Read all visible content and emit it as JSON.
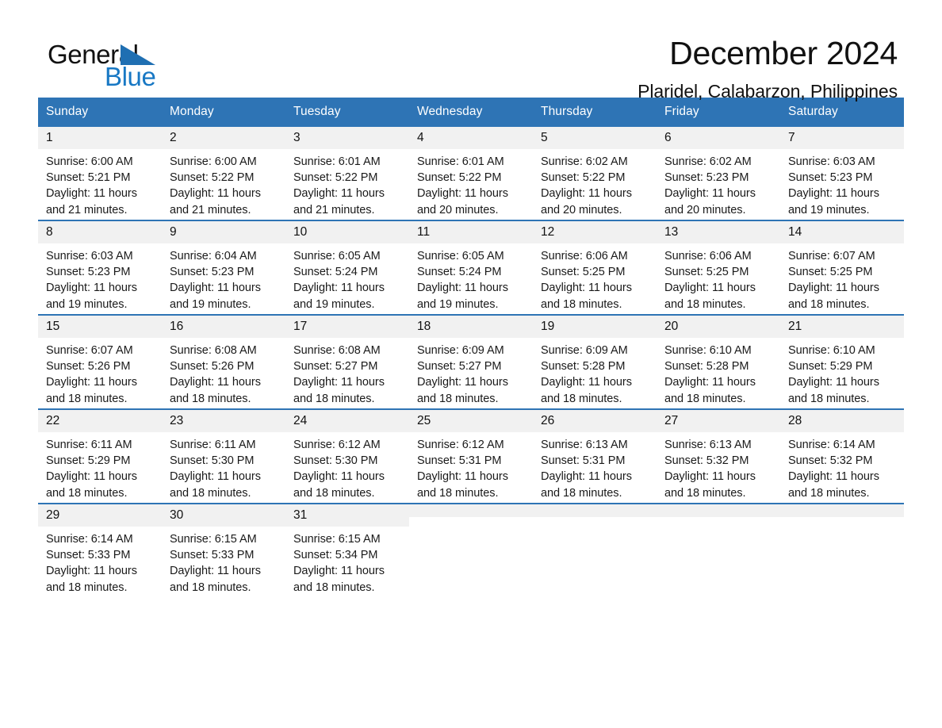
{
  "brand": {
    "name_part1": "General",
    "name_part2": "Blue",
    "triangle_color": "#1F6FB2",
    "blue_color": "#1878C4"
  },
  "header": {
    "title": "December 2024",
    "location": "Plaridel, Calabarzon, Philippines"
  },
  "theme": {
    "header_blue": "#2E74B5",
    "daynum_gray": "#F1F1F1",
    "text_color": "#111111"
  },
  "weekday_headers": [
    "Sunday",
    "Monday",
    "Tuesday",
    "Wednesday",
    "Thursday",
    "Friday",
    "Saturday"
  ],
  "labels": {
    "sunrise_prefix": "Sunrise:",
    "sunset_prefix": "Sunset:",
    "daylight_prefix": "Daylight:"
  },
  "weeks": [
    [
      {
        "day": "1",
        "sunrise": "Sunrise: 6:00 AM",
        "sunset": "Sunset: 5:21 PM",
        "daylight_line1": "Daylight: 11 hours",
        "daylight_line2": "and 21 minutes."
      },
      {
        "day": "2",
        "sunrise": "Sunrise: 6:00 AM",
        "sunset": "Sunset: 5:22 PM",
        "daylight_line1": "Daylight: 11 hours",
        "daylight_line2": "and 21 minutes."
      },
      {
        "day": "3",
        "sunrise": "Sunrise: 6:01 AM",
        "sunset": "Sunset: 5:22 PM",
        "daylight_line1": "Daylight: 11 hours",
        "daylight_line2": "and 21 minutes."
      },
      {
        "day": "4",
        "sunrise": "Sunrise: 6:01 AM",
        "sunset": "Sunset: 5:22 PM",
        "daylight_line1": "Daylight: 11 hours",
        "daylight_line2": "and 20 minutes."
      },
      {
        "day": "5",
        "sunrise": "Sunrise: 6:02 AM",
        "sunset": "Sunset: 5:22 PM",
        "daylight_line1": "Daylight: 11 hours",
        "daylight_line2": "and 20 minutes."
      },
      {
        "day": "6",
        "sunrise": "Sunrise: 6:02 AM",
        "sunset": "Sunset: 5:23 PM",
        "daylight_line1": "Daylight: 11 hours",
        "daylight_line2": "and 20 minutes."
      },
      {
        "day": "7",
        "sunrise": "Sunrise: 6:03 AM",
        "sunset": "Sunset: 5:23 PM",
        "daylight_line1": "Daylight: 11 hours",
        "daylight_line2": "and 19 minutes."
      }
    ],
    [
      {
        "day": "8",
        "sunrise": "Sunrise: 6:03 AM",
        "sunset": "Sunset: 5:23 PM",
        "daylight_line1": "Daylight: 11 hours",
        "daylight_line2": "and 19 minutes."
      },
      {
        "day": "9",
        "sunrise": "Sunrise: 6:04 AM",
        "sunset": "Sunset: 5:23 PM",
        "daylight_line1": "Daylight: 11 hours",
        "daylight_line2": "and 19 minutes."
      },
      {
        "day": "10",
        "sunrise": "Sunrise: 6:05 AM",
        "sunset": "Sunset: 5:24 PM",
        "daylight_line1": "Daylight: 11 hours",
        "daylight_line2": "and 19 minutes."
      },
      {
        "day": "11",
        "sunrise": "Sunrise: 6:05 AM",
        "sunset": "Sunset: 5:24 PM",
        "daylight_line1": "Daylight: 11 hours",
        "daylight_line2": "and 19 minutes."
      },
      {
        "day": "12",
        "sunrise": "Sunrise: 6:06 AM",
        "sunset": "Sunset: 5:25 PM",
        "daylight_line1": "Daylight: 11 hours",
        "daylight_line2": "and 18 minutes."
      },
      {
        "day": "13",
        "sunrise": "Sunrise: 6:06 AM",
        "sunset": "Sunset: 5:25 PM",
        "daylight_line1": "Daylight: 11 hours",
        "daylight_line2": "and 18 minutes."
      },
      {
        "day": "14",
        "sunrise": "Sunrise: 6:07 AM",
        "sunset": "Sunset: 5:25 PM",
        "daylight_line1": "Daylight: 11 hours",
        "daylight_line2": "and 18 minutes."
      }
    ],
    [
      {
        "day": "15",
        "sunrise": "Sunrise: 6:07 AM",
        "sunset": "Sunset: 5:26 PM",
        "daylight_line1": "Daylight: 11 hours",
        "daylight_line2": "and 18 minutes."
      },
      {
        "day": "16",
        "sunrise": "Sunrise: 6:08 AM",
        "sunset": "Sunset: 5:26 PM",
        "daylight_line1": "Daylight: 11 hours",
        "daylight_line2": "and 18 minutes."
      },
      {
        "day": "17",
        "sunrise": "Sunrise: 6:08 AM",
        "sunset": "Sunset: 5:27 PM",
        "daylight_line1": "Daylight: 11 hours",
        "daylight_line2": "and 18 minutes."
      },
      {
        "day": "18",
        "sunrise": "Sunrise: 6:09 AM",
        "sunset": "Sunset: 5:27 PM",
        "daylight_line1": "Daylight: 11 hours",
        "daylight_line2": "and 18 minutes."
      },
      {
        "day": "19",
        "sunrise": "Sunrise: 6:09 AM",
        "sunset": "Sunset: 5:28 PM",
        "daylight_line1": "Daylight: 11 hours",
        "daylight_line2": "and 18 minutes."
      },
      {
        "day": "20",
        "sunrise": "Sunrise: 6:10 AM",
        "sunset": "Sunset: 5:28 PM",
        "daylight_line1": "Daylight: 11 hours",
        "daylight_line2": "and 18 minutes."
      },
      {
        "day": "21",
        "sunrise": "Sunrise: 6:10 AM",
        "sunset": "Sunset: 5:29 PM",
        "daylight_line1": "Daylight: 11 hours",
        "daylight_line2": "and 18 minutes."
      }
    ],
    [
      {
        "day": "22",
        "sunrise": "Sunrise: 6:11 AM",
        "sunset": "Sunset: 5:29 PM",
        "daylight_line1": "Daylight: 11 hours",
        "daylight_line2": "and 18 minutes."
      },
      {
        "day": "23",
        "sunrise": "Sunrise: 6:11 AM",
        "sunset": "Sunset: 5:30 PM",
        "daylight_line1": "Daylight: 11 hours",
        "daylight_line2": "and 18 minutes."
      },
      {
        "day": "24",
        "sunrise": "Sunrise: 6:12 AM",
        "sunset": "Sunset: 5:30 PM",
        "daylight_line1": "Daylight: 11 hours",
        "daylight_line2": "and 18 minutes."
      },
      {
        "day": "25",
        "sunrise": "Sunrise: 6:12 AM",
        "sunset": "Sunset: 5:31 PM",
        "daylight_line1": "Daylight: 11 hours",
        "daylight_line2": "and 18 minutes."
      },
      {
        "day": "26",
        "sunrise": "Sunrise: 6:13 AM",
        "sunset": "Sunset: 5:31 PM",
        "daylight_line1": "Daylight: 11 hours",
        "daylight_line2": "and 18 minutes."
      },
      {
        "day": "27",
        "sunrise": "Sunrise: 6:13 AM",
        "sunset": "Sunset: 5:32 PM",
        "daylight_line1": "Daylight: 11 hours",
        "daylight_line2": "and 18 minutes."
      },
      {
        "day": "28",
        "sunrise": "Sunrise: 6:14 AM",
        "sunset": "Sunset: 5:32 PM",
        "daylight_line1": "Daylight: 11 hours",
        "daylight_line2": "and 18 minutes."
      }
    ],
    [
      {
        "day": "29",
        "sunrise": "Sunrise: 6:14 AM",
        "sunset": "Sunset: 5:33 PM",
        "daylight_line1": "Daylight: 11 hours",
        "daylight_line2": "and 18 minutes."
      },
      {
        "day": "30",
        "sunrise": "Sunrise: 6:15 AM",
        "sunset": "Sunset: 5:33 PM",
        "daylight_line1": "Daylight: 11 hours",
        "daylight_line2": "and 18 minutes."
      },
      {
        "day": "31",
        "sunrise": "Sunrise: 6:15 AM",
        "sunset": "Sunset: 5:34 PM",
        "daylight_line1": "Daylight: 11 hours",
        "daylight_line2": "and 18 minutes."
      },
      {
        "day": "",
        "sunrise": "",
        "sunset": "",
        "daylight_line1": "",
        "daylight_line2": ""
      },
      {
        "day": "",
        "sunrise": "",
        "sunset": "",
        "daylight_line1": "",
        "daylight_line2": ""
      },
      {
        "day": "",
        "sunrise": "",
        "sunset": "",
        "daylight_line1": "",
        "daylight_line2": ""
      },
      {
        "day": "",
        "sunrise": "",
        "sunset": "",
        "daylight_line1": "",
        "daylight_line2": ""
      }
    ]
  ]
}
